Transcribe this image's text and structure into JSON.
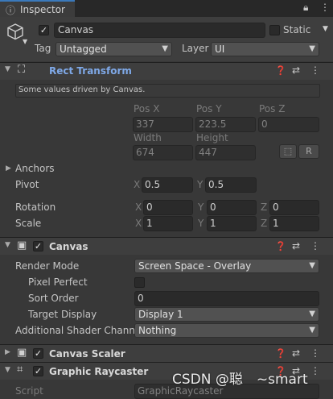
{
  "window": {
    "tab_title": "Inspector"
  },
  "header": {
    "object_name": "Canvas",
    "static_label": "Static",
    "tag_label": "Tag",
    "tag_value": "Untagged",
    "layer_label": "Layer",
    "layer_value": "UI"
  },
  "rect_transform": {
    "title": "Rect Transform",
    "info": "Some values driven by Canvas.",
    "pos_x_label": "Pos X",
    "pos_y_label": "Pos Y",
    "pos_z_label": "Pos Z",
    "pos_x": "337",
    "pos_y": "223.5",
    "pos_z": "0",
    "width_label": "Width",
    "height_label": "Height",
    "width": "674",
    "height": "447",
    "raw_button": "R",
    "anchors_label": "Anchors",
    "pivot_label": "Pivot",
    "pivot_x": "0.5",
    "pivot_y": "0.5",
    "rotation_label": "Rotation",
    "rot_x": "0",
    "rot_y": "0",
    "rot_z": "0",
    "scale_label": "Scale",
    "scale_x": "1",
    "scale_y": "1",
    "scale_z": "1",
    "x": "X",
    "y": "Y",
    "z": "Z"
  },
  "canvas": {
    "title": "Canvas",
    "render_mode_label": "Render Mode",
    "render_mode_value": "Screen Space - Overlay",
    "pixel_perfect_label": "Pixel Perfect",
    "sort_order_label": "Sort Order",
    "sort_order_value": "0",
    "target_display_label": "Target Display",
    "target_display_value": "Display 1",
    "shader_channels_label": "Additional Shader Channe",
    "shader_channels_value": "Nothing"
  },
  "canvas_scaler": {
    "title": "Canvas Scaler"
  },
  "graphic_raycaster": {
    "title": "Graphic Raycaster",
    "script_label": "Script",
    "script_value": "GraphicRaycaster"
  },
  "watermark": "CSDN @聪　~smart",
  "icons": {
    "lock": "lock-icon",
    "menu": "kebab-menu-icon",
    "help": "help-icon",
    "settings": "preset-icon",
    "cube": "gameobject-cube-icon"
  }
}
